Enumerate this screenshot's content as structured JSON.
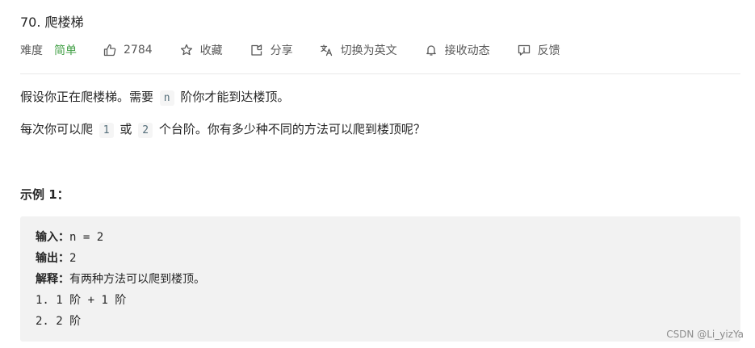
{
  "problem": {
    "title": "70. 爬楼梯",
    "difficulty_label": "难度",
    "difficulty": "简单",
    "likes": "2784",
    "actions": {
      "favorite": "收藏",
      "share": "分享",
      "translate": "切换为英文",
      "notify": "接收动态",
      "feedback": "反馈"
    }
  },
  "description": {
    "p1_before": "假设你正在爬楼梯。需要",
    "p1_code": "n",
    "p1_after": "阶你才能到达楼顶。",
    "p2_before": "每次你可以爬",
    "p2_code1": "1",
    "p2_mid": "或",
    "p2_code2": "2",
    "p2_after": "个台阶。你有多少种不同的方法可以爬到楼顶呢？"
  },
  "example": {
    "title": "示例 1：",
    "input_label": "输入：",
    "input_value": "n = 2",
    "output_label": "输出：",
    "output_value": "2",
    "explain_label": "解释：",
    "explain_value": "有两种方法可以爬到楼顶。",
    "step1": "1. 1 阶 + 1 阶",
    "step2": "2. 2 阶"
  },
  "watermark": "CSDN @Li_yizYa",
  "colors": {
    "difficulty_easy": "#43a047",
    "code_bg": "#f2f2f2"
  },
  "icons": [
    "thumbs-up-icon",
    "star-icon",
    "share-icon",
    "translate-icon",
    "bell-icon",
    "feedback-icon"
  ]
}
